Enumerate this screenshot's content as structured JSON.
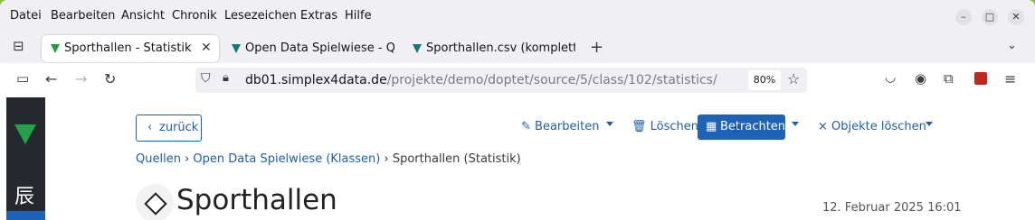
{
  "menubar": {
    "items": [
      "Datei",
      "Bearbeiten",
      "Ansicht",
      "Chronik",
      "Lesezeichen",
      "Extras",
      "Hilfe"
    ],
    "window_controls": [
      "minimize",
      "maximize",
      "close"
    ]
  },
  "tabs": [
    {
      "title": "Sporthallen - Statistik",
      "active": true
    },
    {
      "title": "Open Data Spielwiese - Q",
      "active": false
    },
    {
      "title": "Sporthallen.csv (komplett",
      "active": false
    }
  ],
  "nav": {
    "url_host": "db01.simplex4data.de",
    "url_path": "/projekte/demo/doptet/source/5/class/102/statistics/",
    "zoom": "80%"
  },
  "toolbar": {
    "back_label": "zurück",
    "edit_label": "Bearbeiten",
    "delete_label": "Löschen",
    "view_label": "Betrachten",
    "delete_objects_label": "Objekte löschen"
  },
  "breadcrumb": {
    "source": "Quellen",
    "project": "Open Data Spielwiese (Klassen)",
    "current": "Sporthallen (Statistik)"
  },
  "page": {
    "title": "Sporthallen",
    "timestamp": "12. Februar 2025 16:01"
  },
  "colors": {
    "accent": "#1f63b8",
    "link": "#1f5fa8",
    "sidebar": "#25292e",
    "desktop": "#86c540",
    "brand_green": "#23a348"
  }
}
